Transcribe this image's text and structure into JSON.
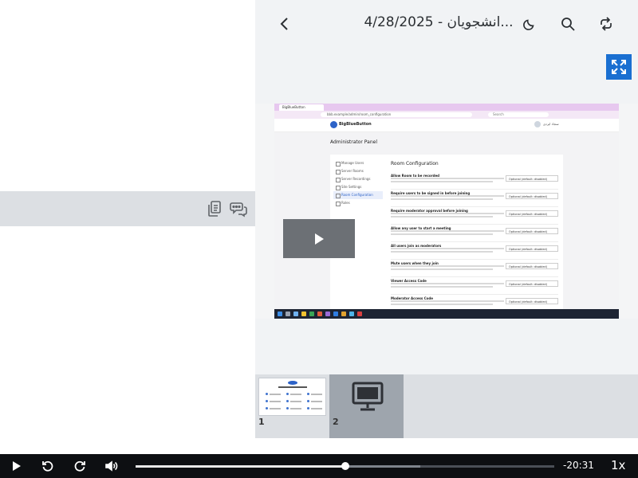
{
  "header": {
    "title": "انشجویان - 4/28/2025...",
    "back_icon": "chevron-left-icon",
    "theme_icon": "moon-icon",
    "search_icon": "search-icon",
    "sync_icon": "sync-icon",
    "fullscreen_icon": "fullscreen-icon"
  },
  "chat_bar": {
    "copy_icon": "copy-icon",
    "chat_icon": "chat-icon"
  },
  "video": {
    "play_overlay_icon": "play-icon",
    "screen": {
      "tab_title": "BigBlueButton",
      "url": "bbb.example/admin/room_configuration",
      "search_placeholder": "Search",
      "brand": "BigBlueButton",
      "user_name": "سجاد ایزدی",
      "page_title": "Administrator Panel",
      "nav_items": [
        "Manage Users",
        "Server Rooms",
        "Server Recordings",
        "Site Settings",
        "Room Configuration",
        "Roles"
      ],
      "active_nav": "Room Configuration",
      "section_title": "Room Configuration",
      "settings": [
        {
          "title": "Allow Room to be recorded",
          "value": "Optional (default: disabled)"
        },
        {
          "title": "Require users to be signed in before joining",
          "value": "Optional (default: disabled)"
        },
        {
          "title": "Require moderator approval before joining",
          "value": "Optional (default: disabled)"
        },
        {
          "title": "Allow any user to start a meeting",
          "value": "Optional (default: disabled)"
        },
        {
          "title": "All users join as moderators",
          "value": "Optional (default: disabled)"
        },
        {
          "title": "Mute users when they join",
          "value": "Optional (default: disabled)"
        },
        {
          "title": "Viewer Access Code",
          "value": "Optional (default: disabled)"
        },
        {
          "title": "Moderator Access Code",
          "value": "Optional (default: disabled)"
        }
      ]
    }
  },
  "thumbnails": [
    {
      "number": "1",
      "kind": "slide"
    },
    {
      "number": "2",
      "kind": "screenshare",
      "icon": "monitor-icon"
    }
  ],
  "player": {
    "time_remaining": "-20:31",
    "rate": "1x",
    "progress_fraction": 0.5,
    "buffered_fraction": 0.68,
    "colors": {
      "accent": "#1a6fd1",
      "bar_bg": "#0d0f12"
    }
  }
}
